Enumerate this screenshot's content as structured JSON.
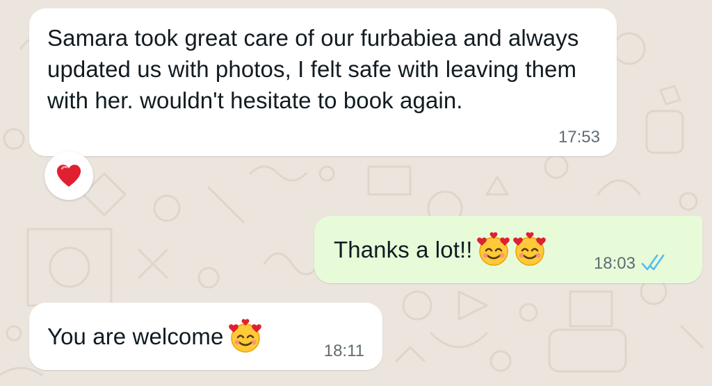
{
  "messages": [
    {
      "direction": "incoming",
      "text": "Samara took great care of our furbabiea and always updated us with photos, I felt safe with leaving them with her. wouldn't hesitate to book again.",
      "time": "17:53",
      "reaction": "heart-emoji"
    },
    {
      "direction": "outgoing",
      "text": "Thanks a lot!!",
      "emoji": [
        "smiling-face-with-hearts",
        "smiling-face-with-hearts"
      ],
      "time": "18:03",
      "status": "read",
      "status_icon": "double-check-icon"
    },
    {
      "direction": "incoming",
      "text": "You are welcome",
      "emoji": [
        "smiling-face-with-hearts"
      ],
      "time": "18:11"
    }
  ],
  "colors": {
    "chat_background": "#ece5dd",
    "incoming_bubble": "#ffffff",
    "outgoing_bubble": "#e7fbd9",
    "timestamp": "#5f6b72",
    "read_ticks": "#53bdeb",
    "reaction_heart": "#e0202f"
  }
}
